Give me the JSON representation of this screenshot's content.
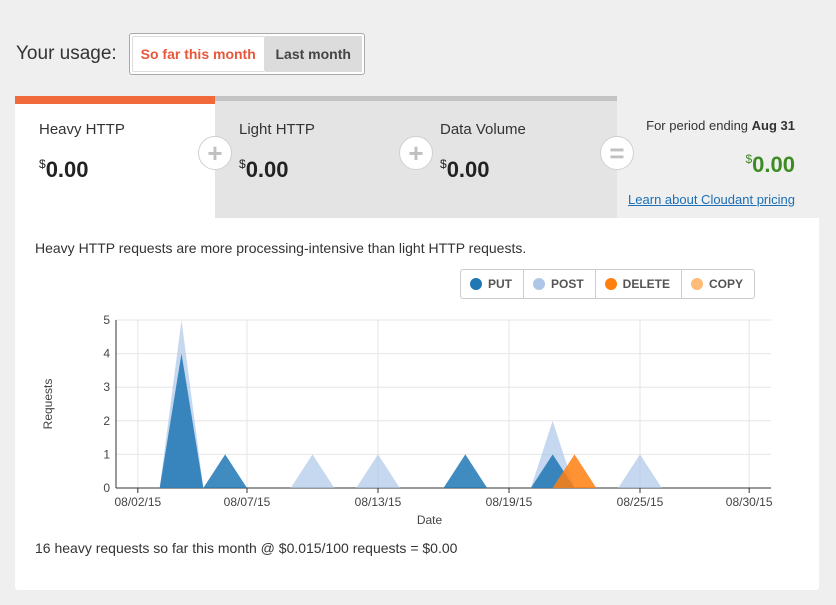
{
  "usage": {
    "label": "Your usage:",
    "options": [
      {
        "label": "So far this month",
        "active": true
      },
      {
        "label": "Last month",
        "active": false
      }
    ]
  },
  "tabs": [
    {
      "title": "Heavy HTTP",
      "currency": "$",
      "amount": "0.00",
      "active": true
    },
    {
      "title": "Light HTTP",
      "currency": "$",
      "amount": "0.00",
      "active": false
    },
    {
      "title": "Data Volume",
      "currency": "$",
      "amount": "0.00",
      "active": false
    }
  ],
  "operators": [
    "+",
    "+",
    "="
  ],
  "summary": {
    "period_prefix": "For period ending",
    "period_date": "Aug 31",
    "currency": "$",
    "total": "0.00",
    "pricing_link": "Learn about Cloudant pricing"
  },
  "panel": {
    "description": "Heavy HTTP requests are more processing-intensive than light HTTP requests.",
    "footer": "16 heavy requests so far this month @ $0.015/100 requests = $0.00"
  },
  "legend": [
    {
      "label": "PUT",
      "color": "#1f77b4"
    },
    {
      "label": "POST",
      "color": "#aec7e8"
    },
    {
      "label": "DELETE",
      "color": "#ff7f0e"
    },
    {
      "label": "COPY",
      "color": "#ffbb78"
    }
  ],
  "chart_data": {
    "type": "area",
    "xlabel": "Date",
    "ylabel": "Requests",
    "ylim": [
      0,
      5
    ],
    "yticks": [
      0,
      1,
      2,
      3,
      4,
      5
    ],
    "xlim": [
      "2015-08-01",
      "2015-08-31"
    ],
    "xticks": [
      "08/02/15",
      "08/07/15",
      "08/13/15",
      "08/19/15",
      "08/25/15",
      "08/30/15"
    ],
    "grid": true,
    "series": [
      {
        "name": "PUT",
        "color": "#1f77b4",
        "points": [
          [
            "2015-08-04",
            4
          ],
          [
            "2015-08-06",
            1
          ],
          [
            "2015-08-17",
            1
          ],
          [
            "2015-08-21",
            1
          ]
        ]
      },
      {
        "name": "POST",
        "color": "#aec7e8",
        "points": [
          [
            "2015-08-04",
            5
          ],
          [
            "2015-08-10",
            1
          ],
          [
            "2015-08-13",
            1
          ],
          [
            "2015-08-21",
            2
          ],
          [
            "2015-08-25",
            1
          ]
        ]
      },
      {
        "name": "DELETE",
        "color": "#ff7f0e",
        "points": [
          [
            "2015-08-22",
            1
          ]
        ]
      },
      {
        "name": "COPY",
        "color": "#ffbb78",
        "points": []
      }
    ]
  }
}
